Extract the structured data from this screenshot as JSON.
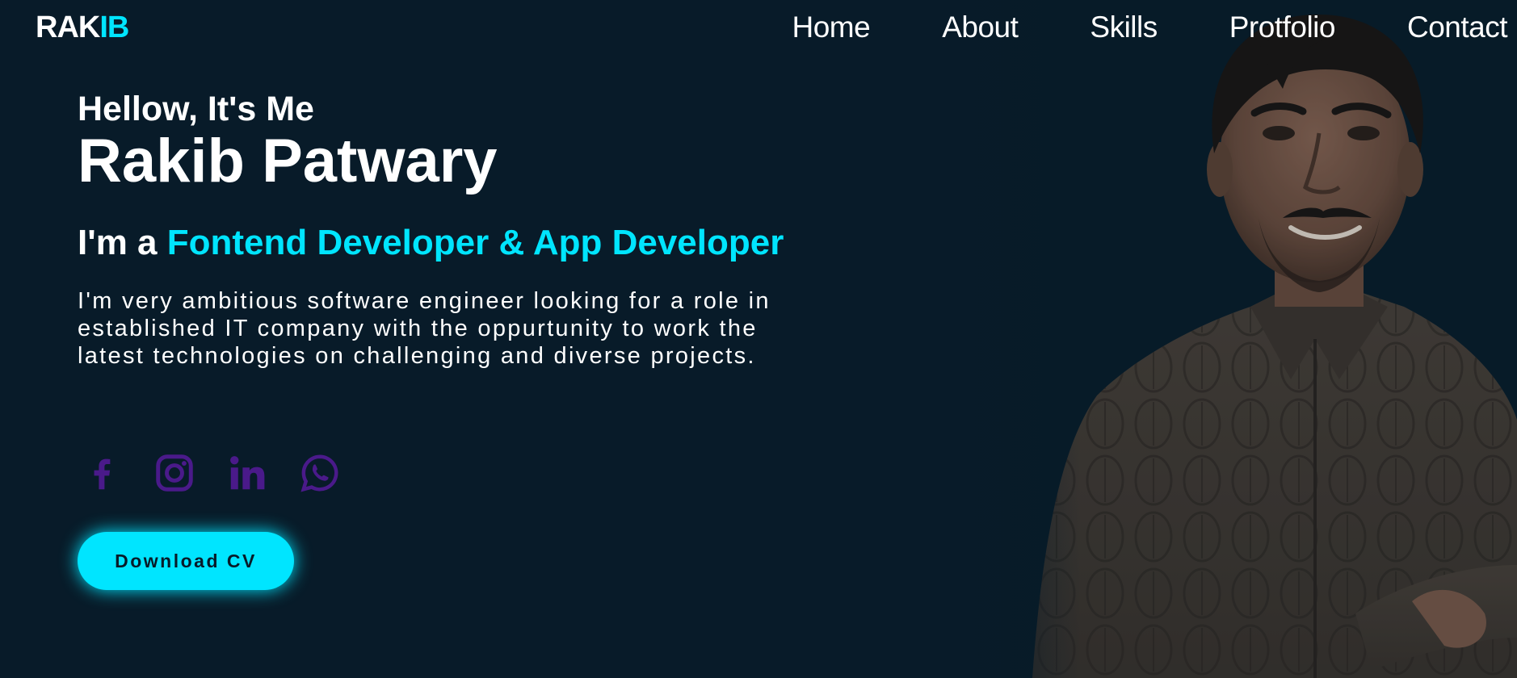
{
  "header": {
    "logo": {
      "part1": "RAK",
      "part2": "IB"
    },
    "nav": [
      "Home",
      "About",
      "Skills",
      "Protfolio",
      "Contact"
    ]
  },
  "hero": {
    "greeting": "Hellow, It's Me",
    "name": "Rakib Patwary",
    "role_prefix": "I'm a ",
    "role_highlight": "Fontend Developer & App Developer",
    "bio": "I'm very ambitious software engineer looking for a role in established IT company with the oppurtunity to work the latest technologies on challenging and diverse projects.",
    "download_label": "Download CV"
  },
  "social": [
    "facebook-icon",
    "instagram-icon",
    "linkedin-icon",
    "whatsapp-icon"
  ],
  "colors": {
    "background": "#081b29",
    "accent": "#00e5ff",
    "social_icon": "#4a1a8a",
    "text": "#ffffff"
  }
}
